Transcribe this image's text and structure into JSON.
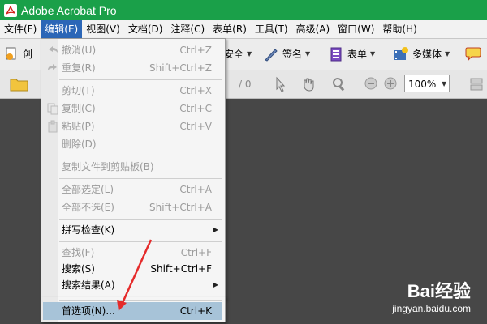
{
  "window": {
    "title": "Adobe Acrobat Pro"
  },
  "menubar": [
    {
      "label": "文件(F)"
    },
    {
      "label": "编辑(E)",
      "active": true
    },
    {
      "label": "视图(V)"
    },
    {
      "label": "文档(D)"
    },
    {
      "label": "注释(C)"
    },
    {
      "label": "表单(R)"
    },
    {
      "label": "工具(T)"
    },
    {
      "label": "高级(A)"
    },
    {
      "label": "窗口(W)"
    },
    {
      "label": "帮助(H)"
    }
  ],
  "toolbar1": {
    "create_label": "创",
    "security_label": "安全",
    "sign_label": "签名",
    "forms_label": "表单",
    "multimedia_label": "多媒体"
  },
  "toolbar2": {
    "page_total": "/ 0",
    "zoom": "100%"
  },
  "edit_menu": {
    "undo": {
      "label": "撤消(U)",
      "shortcut": "Ctrl+Z"
    },
    "redo": {
      "label": "重复(R)",
      "shortcut": "Shift+Ctrl+Z"
    },
    "cut": {
      "label": "剪切(T)",
      "shortcut": "Ctrl+X"
    },
    "copy": {
      "label": "复制(C)",
      "shortcut": "Ctrl+C"
    },
    "paste": {
      "label": "粘贴(P)",
      "shortcut": "Ctrl+V"
    },
    "delete": {
      "label": "删除(D)"
    },
    "copy_to_clipboard": {
      "label": "复制文件到剪贴板(B)"
    },
    "select_all": {
      "label": "全部选定(L)",
      "shortcut": "Ctrl+A"
    },
    "deselect_all": {
      "label": "全部不选(E)",
      "shortcut": "Shift+Ctrl+A"
    },
    "spell_check": {
      "label": "拼写检查(K)"
    },
    "find": {
      "label": "查找(F)",
      "shortcut": "Ctrl+F"
    },
    "search": {
      "label": "搜索(S)",
      "shortcut": "Shift+Ctrl+F"
    },
    "search_results": {
      "label": "搜索结果(A)"
    },
    "preferences": {
      "label": "首选项(N)...",
      "shortcut": "Ctrl+K"
    }
  },
  "watermark": {
    "brand": "Bai经验",
    "url": "jingyan.baidu.com"
  },
  "colors": {
    "titlebar": "#1aa049",
    "menu_active": "#2b66b7",
    "highlight": "#a7c3d8",
    "arrow": "#e52b2b"
  }
}
